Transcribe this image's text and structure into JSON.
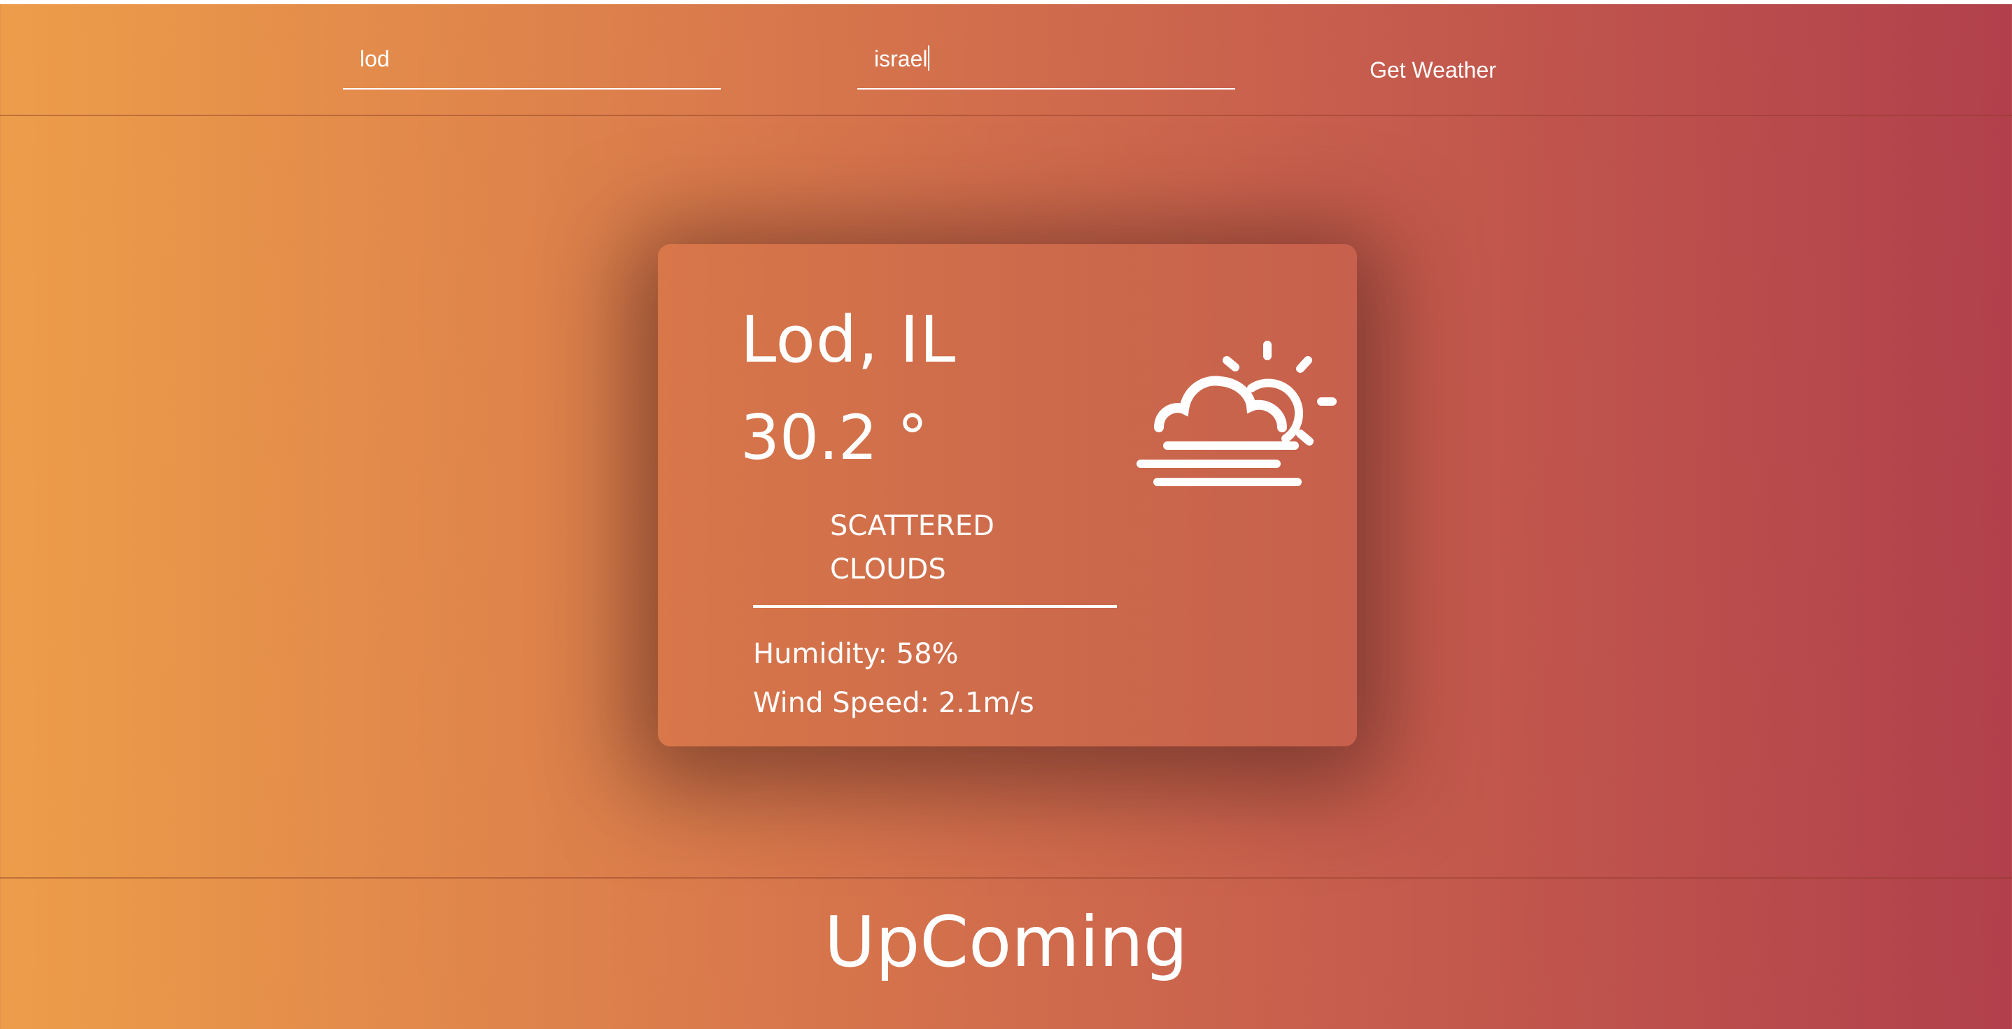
{
  "search": {
    "city_value": "lod",
    "country_value": "israel",
    "button_label": "Get Weather"
  },
  "current": {
    "location": "Lod, IL",
    "temperature": "30.2 °",
    "description": "Scattered Clouds",
    "humidity": "Humidity: 58%",
    "wind": "Wind Speed: 2.1m/s",
    "icon": "partly-cloudy-fog-icon"
  },
  "forecast": {
    "heading": "UpComing"
  },
  "colors": {
    "gradient_start": "#ed9d4a",
    "gradient_end": "#b1404c",
    "card_background": "#d27049",
    "text": "#ffffff"
  }
}
